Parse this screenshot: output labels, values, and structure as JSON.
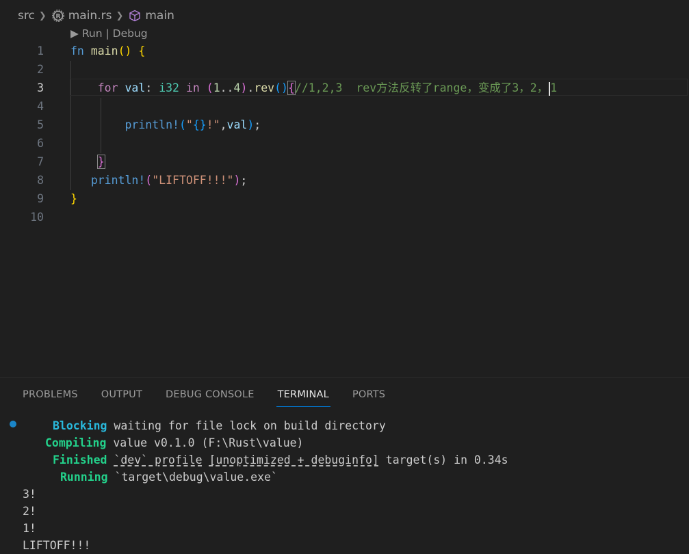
{
  "breadcrumb": {
    "folder": "src",
    "file": "main.rs",
    "file_icon": "rust-gear-icon",
    "symbol": "main",
    "symbol_icon": "cube-icon"
  },
  "codelens": {
    "label": "▶ Run | Debug"
  },
  "editor": {
    "line_numbers": [
      "1",
      "2",
      "3",
      "4",
      "5",
      "6",
      "7",
      "8",
      "9",
      "10"
    ],
    "active_line": 3,
    "lines": [
      "fn main() {",
      "",
      "    for val: i32 in (1..4).rev(){//1,2,3  rev方法反转了range，变成了3，2，1",
      "",
      "        println!(\"{}!\",val);",
      "",
      "    }",
      "   println!(\"LIFTOFF!!!\");",
      "}",
      ""
    ]
  },
  "panel": {
    "tabs": [
      "PROBLEMS",
      "OUTPUT",
      "DEBUG CONSOLE",
      "TERMINAL",
      "PORTS"
    ],
    "active_tab": "TERMINAL"
  },
  "terminal": {
    "lines": [
      {
        "status": "Blocking",
        "text": "waiting for file lock on build directory"
      },
      {
        "status": "Compiling",
        "text": "value v0.1.0 (F:\\Rust\\value)"
      },
      {
        "status": "Finished",
        "text_pre": "",
        "text_ul1": "`dev` profile",
        "text_mid": " ",
        "text_ul2": "[unoptimized + debuginfo]",
        "text_post": " target(s) in 0.34s"
      },
      {
        "status": "Running",
        "text": "`target\\debug\\value.exe`"
      },
      {
        "status": "",
        "text": "3!"
      },
      {
        "status": "",
        "text": "2!"
      },
      {
        "status": "",
        "text": "1!"
      },
      {
        "status": "",
        "text": "LIFTOFF!!!"
      }
    ]
  },
  "colors": {
    "background": "#1f1f1f",
    "keyword": "#569cd6",
    "comment": "#6a9955",
    "string": "#ce9178",
    "terminal_green": "#23d18b",
    "terminal_cyan": "#29b8db",
    "tab_active_underline": "#0078d4"
  }
}
